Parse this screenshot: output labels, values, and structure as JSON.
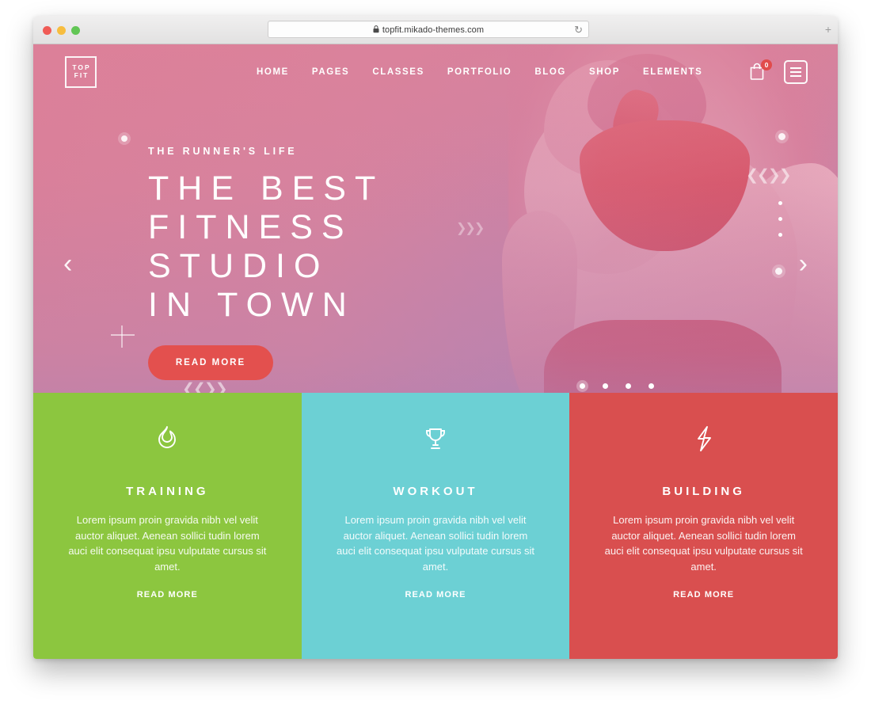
{
  "browser": {
    "url": "topfit.mikado-themes.com",
    "lock_icon": "lock-icon",
    "reload_icon": "reload-icon",
    "new_tab_icon": "plus-icon",
    "traffic_lights": [
      "close-red",
      "minimize-yellow",
      "zoom-green"
    ]
  },
  "header": {
    "logo": {
      "line1": "TOP",
      "line2": "FIT"
    },
    "nav": [
      {
        "label": "HOME"
      },
      {
        "label": "PAGES"
      },
      {
        "label": "CLASSES"
      },
      {
        "label": "PORTFOLIO"
      },
      {
        "label": "BLOG"
      },
      {
        "label": "SHOP"
      },
      {
        "label": "ELEMENTS"
      }
    ],
    "cart": {
      "icon": "shopping-bag-icon",
      "count": "0"
    },
    "menu": {
      "icon": "hamburger-menu-icon"
    }
  },
  "hero": {
    "subtitle": "THE RUNNER'S LIFE",
    "title": "THE BEST\nFITNESS\nSTUDIO\nIN TOWN",
    "button_label": "READ MORE",
    "prev_arrow": "‹",
    "next_arrow": "›",
    "slider_dots": 4,
    "active_slide": 1,
    "fullscreen_icon": "fullscreen-icon",
    "gradient_top": "#dd8098",
    "gradient_bottom": "#b583b0",
    "button_color": "#e3504e"
  },
  "features": [
    {
      "icon": "flame-icon",
      "title": "TRAINING",
      "desc": "Lorem ipsum proin gravida nibh vel velit auctor aliquet. Aenean sollici tudin lorem auci elit consequat ipsu vulputate cursus sit amet.",
      "link": "READ MORE",
      "color": "#8CC63F"
    },
    {
      "icon": "trophy-icon",
      "title": "WORKOUT",
      "desc": "Lorem ipsum proin gravida nibh vel velit auctor aliquet. Aenean sollici tudin lorem auci elit consequat ipsu vulputate cursus sit amet.",
      "link": "READ MORE",
      "color": "#6CD0D4"
    },
    {
      "icon": "lightning-bolt-icon",
      "title": "BUILDING",
      "desc": "Lorem ipsum proin gravida nibh vel velit auctor aliquet. Aenean sollici tudin lorem auci elit consequat ipsu vulputate cursus sit amet.",
      "link": "READ MORE",
      "color": "#D94F4F"
    }
  ]
}
